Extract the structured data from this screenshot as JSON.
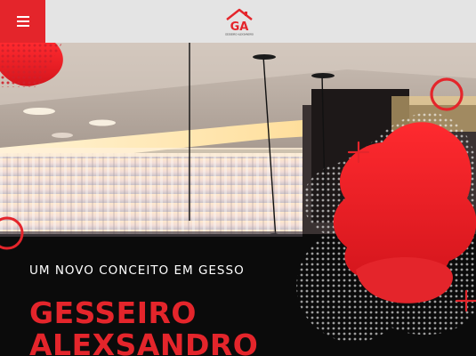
{
  "header": {
    "menu_icon": "hamburger-menu-icon",
    "logo_letters": "GA",
    "logo_caption": "GESSEIRO ALEXSANDRO"
  },
  "hero": {
    "tagline": "UM NOVO CONCEITO EM GESSO",
    "headline_line1": "GESSEIRO",
    "headline_line2": "ALEXSANDRO"
  },
  "colors": {
    "accent_red": "#e4252b",
    "header_bg": "#e4e4e4",
    "hero_bg": "#0d0d0d",
    "text_white": "#ffffff"
  }
}
